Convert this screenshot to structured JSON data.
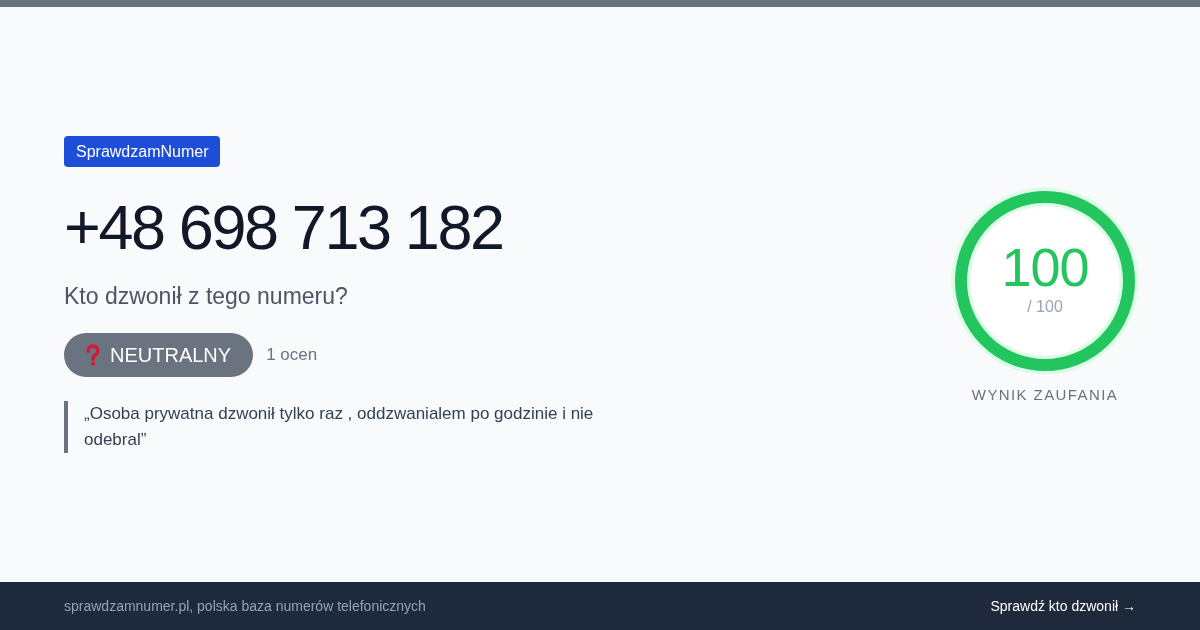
{
  "brand_tag": "SprawdzamNumer",
  "phone_number": "+48 698 713 182",
  "question": "Kto dzwonił z tego numeru?",
  "rating": {
    "label": "NEUTRALNY",
    "count": "1 ocen"
  },
  "quote": "„Osoba prywatna dzwonił tylko raz , oddzwanialem po godzinie i nie odebral”",
  "trust_score": {
    "value": "100",
    "max": "/ 100",
    "level": 1,
    "label": "WYNIK ZAUFANIA"
  },
  "footer": {
    "site_text": "sprawdzamnumer.pl, polska baza numerów telefonicznych",
    "link": "Sprawdź kto dzwonił →"
  }
}
